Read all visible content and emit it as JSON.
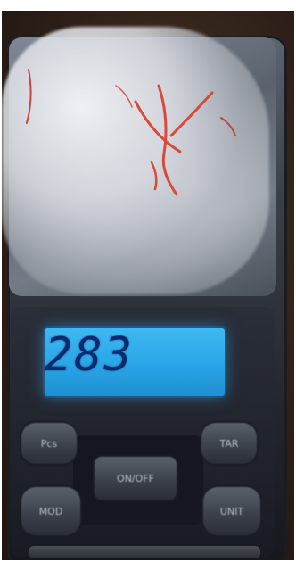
{
  "display": {
    "value": "283",
    "backlight_color": "#2ea8ec"
  },
  "buttons": {
    "top_left": "Pcs",
    "top_right": "TAR",
    "center": "ON/OFF",
    "bottom_left": "MOD",
    "bottom_right": "UNIT"
  },
  "sample": {
    "fiber_color": "#d84a3c"
  }
}
